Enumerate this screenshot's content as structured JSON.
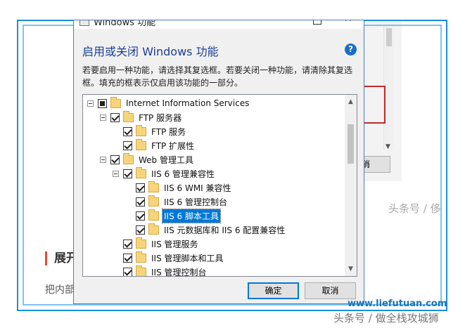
{
  "background": {
    "cancel_fragment": "消",
    "watermark_fragment": "头条号 / 侈",
    "heading_fragment": "展开",
    "text_fragment": "把内部"
  },
  "dialog": {
    "title": "Windows 功能",
    "heading": "启用或关闭 Windows 功能",
    "help_label": "?",
    "description": "若要启用一种功能，请选择其复选框。若要关闭一种功能，请清除其复选框。填充的框表示仅启用该功能的一部分。",
    "tree": [
      {
        "label": "Internet Information Services",
        "state": "partial",
        "expander": true,
        "depth": 0
      },
      {
        "label": "FTP 服务器",
        "state": "checked",
        "expander": true,
        "depth": 1
      },
      {
        "label": "FTP 服务",
        "state": "checked",
        "expander": false,
        "depth": 2
      },
      {
        "label": "FTP 扩展性",
        "state": "checked",
        "expander": false,
        "depth": 2
      },
      {
        "label": "Web 管理工具",
        "state": "checked",
        "expander": true,
        "depth": 1
      },
      {
        "label": "IIS 6 管理兼容性",
        "state": "checked",
        "expander": true,
        "depth": 2
      },
      {
        "label": "IIS 6 WMI 兼容性",
        "state": "checked",
        "expander": false,
        "depth": 3
      },
      {
        "label": "IIS 6 管理控制台",
        "state": "checked",
        "expander": false,
        "depth": 3
      },
      {
        "label": "IIS 6 脚本工具",
        "state": "checked",
        "expander": false,
        "depth": 3,
        "selected": true
      },
      {
        "label": "IIS 元数据库和 IIS 6 配置兼容性",
        "state": "checked",
        "expander": false,
        "depth": 3
      },
      {
        "label": "IIS 管理服务",
        "state": "checked",
        "expander": false,
        "depth": 2
      },
      {
        "label": "IIS 管理脚本和工具",
        "state": "checked",
        "expander": false,
        "depth": 2
      },
      {
        "label": "IIS 管理控制台",
        "state": "checked",
        "expander": false,
        "depth": 2
      }
    ],
    "ok_label": "确定",
    "cancel_label": "取消"
  },
  "watermarks": {
    "site": "www.liefutuan.com",
    "author": "头条号 / 做全栈攻城狮"
  },
  "colors": {
    "frame_outer": "#1b8ed8",
    "frame_inner": "#7bc3ee",
    "heading": "#1c3f95",
    "selection": "#0078d7",
    "folder": "#f6d47c"
  }
}
